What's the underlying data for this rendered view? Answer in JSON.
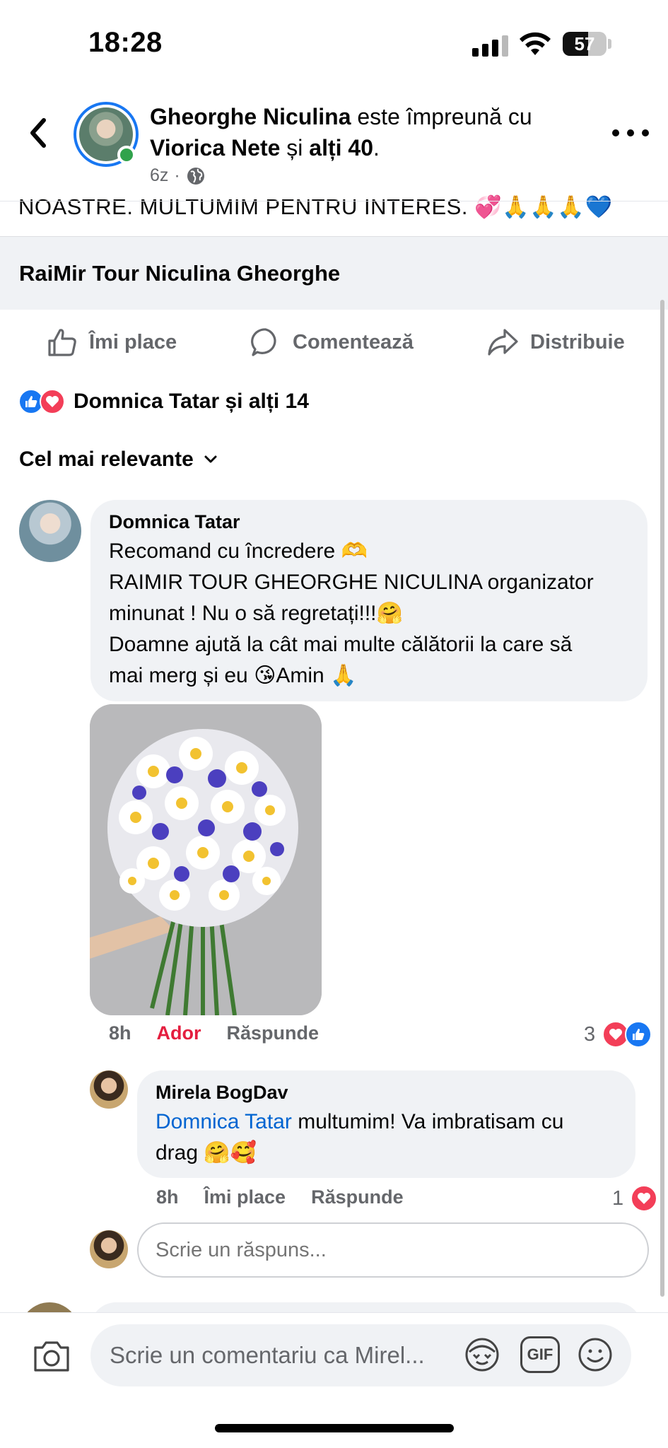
{
  "status_bar": {
    "time": "18:28",
    "battery": "57"
  },
  "header": {
    "author": "Gheorghe Niculina",
    "with_text": " este împreună cu",
    "tagged": "Viorica Nete",
    "and_text": " și ",
    "others": "alți 40",
    "period": ".",
    "time_ago": "6z",
    "separator": "·",
    "privacy_icon": "globe-icon"
  },
  "post": {
    "text_tail": "NOASTRE. MULTUMIM PENTRU INTERES. 💞🙏🙏🙏💙",
    "link_title": "RaiMir Tour Niculina Gheorghe"
  },
  "actions": {
    "like": "Îmi place",
    "comment": "Comentează",
    "share": "Distribuie"
  },
  "reactions": {
    "summary": "Domnica Tatar și alți 14",
    "icons": [
      "like-icon",
      "love-icon"
    ]
  },
  "sort": {
    "label": "Cel mai relevante"
  },
  "comments": [
    {
      "author": "Domnica Tatar",
      "lines": [
        "Recomand cu încredere 🫶",
        "RAIMIR TOUR GHEORGHE NICULINA organizator",
        "minunat ! Nu o să regretați!!!🤗",
        "Doamne ajută la cât mai multe călătorii la care să",
        "mai merg și eu 😘Amin 🙏"
      ],
      "time": "8h",
      "reaction_label": "Ador",
      "reply_label": "Răspunde",
      "reaction_count": "3",
      "reaction_color": "#e41e3f"
    },
    {
      "author": "Mirela BogDav",
      "mention": "Domnica Tatar",
      "line1_rest": " multumim! Va imbratisam cu",
      "line2": "drag 🤗🥰",
      "time": "8h",
      "like_label": "Îmi place",
      "reply_label": "Răspunde",
      "reaction_count": "1"
    }
  ],
  "reply_box": {
    "placeholder": "Scrie un răspuns..."
  },
  "composer": {
    "placeholder": "Scrie un comentariu ca Mirel...",
    "gif_label": "GIF"
  },
  "colors": {
    "accent": "#1877f2",
    "love": "#f33e58",
    "online": "#31a24c",
    "mention": "#0064d1"
  }
}
